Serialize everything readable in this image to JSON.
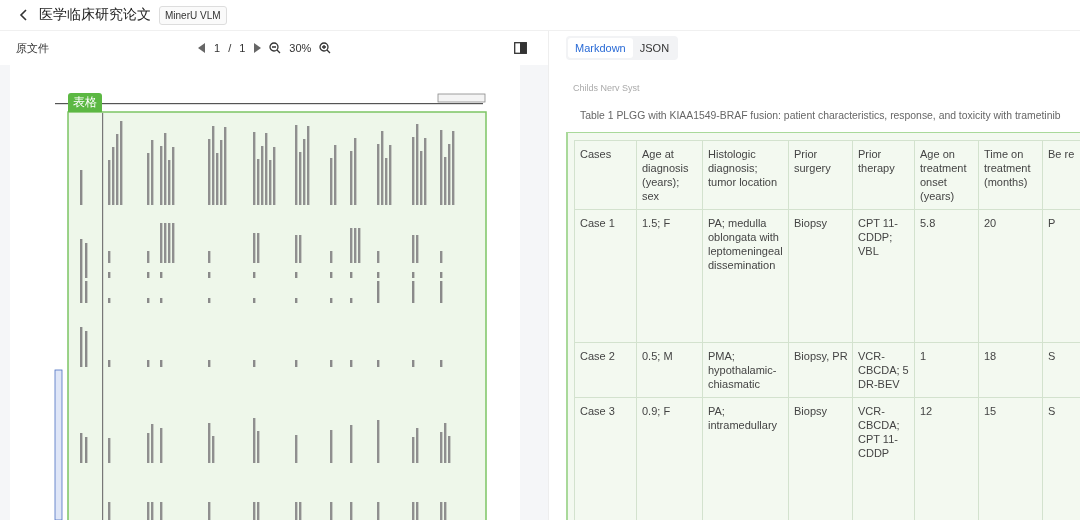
{
  "header": {
    "title": "医学临床研究论文",
    "badge": "MinerU VLM"
  },
  "source_pane": {
    "label": "原文件",
    "page": "1",
    "page_separator": "/",
    "page_count": "1",
    "zoom": "30%",
    "document": {
      "kind": "picture",
      "section_tag": "表格"
    }
  },
  "result_pane": {
    "tabs": [
      {
        "label": "Markdown",
        "selected": true
      },
      {
        "label": "JSON",
        "selected": false
      }
    ],
    "journal": "Childs Nerv Syst",
    "caption": "Table 1 PLGG with KIAA1549-BRAF fusion: patient characteristics, response, and toxicity with trametinib",
    "table": {
      "columns": [
        "Cases",
        "Age at diagnosis (years); sex",
        "Histologic diagnosis; tumor location",
        "Prior surgery",
        "Prior therapy",
        "Age on treatment onset (years)",
        "Time on treatment (months)",
        "Be re"
      ],
      "rows": [
        [
          "Case 1",
          "1.5; F",
          "PA; medulla oblongata with leptomeningeal dissemination",
          "Biopsy",
          "CPT 11-CDDP; VBL",
          "5.8",
          "20",
          "P"
        ],
        [
          "Case 2",
          "0.5; M",
          "PMA; hypothalamic-chiasmatic",
          "Biopsy, PR",
          "VCR-CBCDA; 5 DR-BEV",
          "1",
          "18",
          "S"
        ],
        [
          "Case 3",
          "0.9; F",
          "PA; intramedullary",
          "Biopsy",
          "VCR-CBCDA; CPT 11-CDDP",
          "12",
          "15",
          "S"
        ]
      ]
    }
  }
}
